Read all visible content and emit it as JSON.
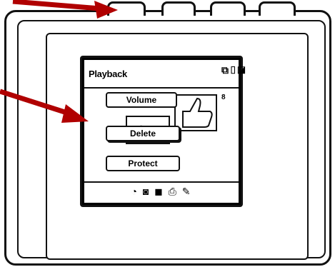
{
  "screen": {
    "title": "Playback",
    "mode_icons": "⧉▯◪",
    "image_count": "8",
    "menu": {
      "volume_label": "Volume",
      "delete_label": "Delete",
      "protect_label": "Protect"
    },
    "bottom_icons": [
      "slideshow-icon",
      "camera-icon",
      "playback-icon",
      "print-icon",
      "settings-icon"
    ],
    "bottom_glyphs": "◔ ◙ ◼ ⎙ ✎"
  },
  "colors": {
    "arrow": "#b00000",
    "outline": "#111111"
  }
}
